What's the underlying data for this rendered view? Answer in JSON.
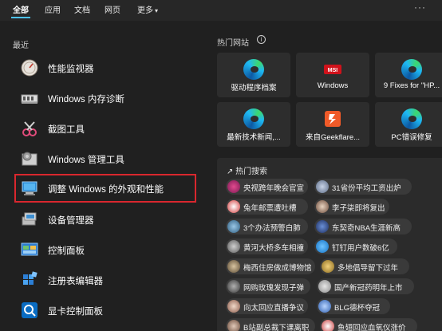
{
  "tabs": {
    "all": "全部",
    "apps": "应用",
    "docs": "文档",
    "web": "网页",
    "more": "更多",
    "more_arrow": "▾",
    "dots": "···"
  },
  "left": {
    "recent_title": "最近",
    "apps": [
      {
        "label": "性能监视器",
        "icon": "performance-monitor-icon"
      },
      {
        "label": "Windows 内存诊断",
        "icon": "memory-diagnostic-icon"
      },
      {
        "label": "截图工具",
        "icon": "snipping-tool-icon"
      },
      {
        "label": "Windows 管理工具",
        "icon": "admin-tools-icon"
      },
      {
        "label": "调整 Windows 的外观和性能",
        "icon": "performance-options-icon"
      },
      {
        "label": "设备管理器",
        "icon": "device-manager-icon"
      },
      {
        "label": "控制面板",
        "icon": "control-panel-icon"
      },
      {
        "label": "注册表编辑器",
        "icon": "registry-editor-icon"
      },
      {
        "label": "显卡控制面板",
        "icon": "graphics-control-panel-icon"
      }
    ]
  },
  "right": {
    "top_sites_title": "热门网站",
    "info": "i",
    "sites": [
      {
        "name": "驱动程序档案",
        "icon": "edge-icon"
      },
      {
        "name": "Windows",
        "icon": "msi-logo-icon",
        "badge": "MSI"
      },
      {
        "name": "9 Fixes for \"HP...",
        "icon": "edge-icon"
      },
      {
        "name": "最新技术新闻,...",
        "icon": "edge-icon"
      },
      {
        "name": "来自Geekflare...",
        "icon": "geekflare-icon"
      },
      {
        "name": "PC错误修复",
        "icon": "edge-icon"
      }
    ],
    "hot_search_title": "热门搜索",
    "hot_arrow": "↗",
    "hot": [
      "央视跨年晚会官宣",
      "31省份平均工资出炉",
      "兔年邮票遭吐槽",
      "李子柒即将复出",
      "3个办法预警白肺",
      "东契奇NBA生涯新高",
      "黄河大桥多车相撞",
      "钉钉用户数破6亿",
      "梅西住房做成博物馆",
      "多地倡导留下过年",
      "网购玫瑰发现子弹",
      "国产新冠药明年上市",
      "向太回应直播争议",
      "BLG德杯夺冠",
      "B站副总裁下课离职",
      "鱼翅回应血氧仪涨价"
    ]
  },
  "colors": {
    "accent": "#4cc2ff",
    "highlight_border": "#d9272e",
    "background": "#202020"
  }
}
